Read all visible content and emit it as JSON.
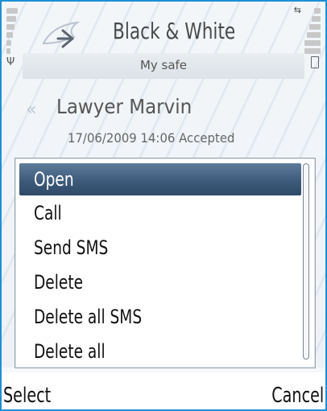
{
  "app": {
    "title": "Black & White",
    "subtitle": "My safe"
  },
  "status": {
    "signal_icon": "signal-icon",
    "battery_icon": "battery-icon",
    "usb_icon": "usb-icon"
  },
  "contact": {
    "name": "Lawyer Marvin",
    "meta": "17/06/2009 14:06 Accepted"
  },
  "menu": {
    "items": [
      {
        "label": "Open",
        "selected": true
      },
      {
        "label": "Call"
      },
      {
        "label": "Send SMS"
      },
      {
        "label": "Delete"
      },
      {
        "label": "Delete all SMS"
      },
      {
        "label": "Delete all"
      }
    ]
  },
  "softkeys": {
    "left": "Select",
    "right": "Cancel"
  },
  "colors": {
    "frame_border": "#1e8fd6",
    "selection": "#3d5a7a"
  }
}
